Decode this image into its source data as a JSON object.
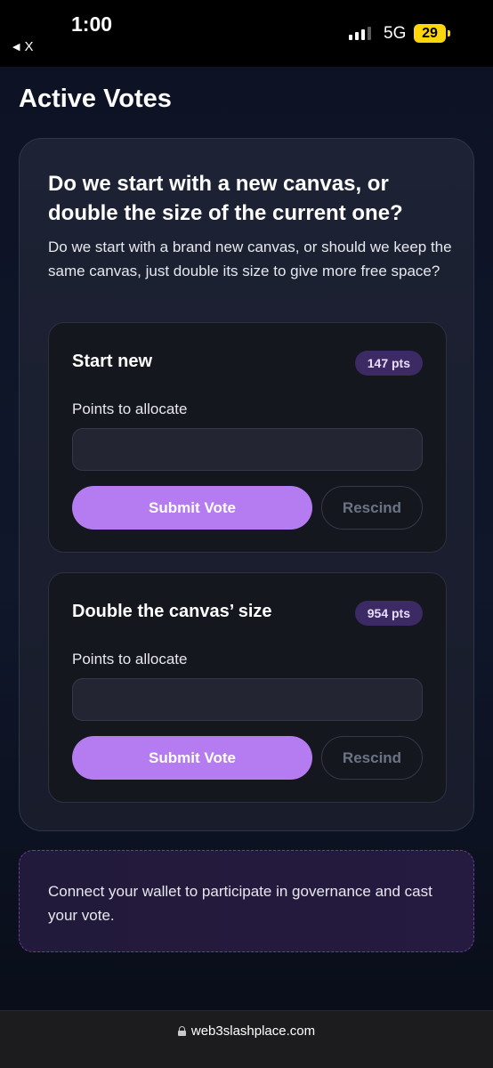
{
  "status_bar": {
    "time": "1:00",
    "back_label": "X",
    "network": "5G",
    "battery": "29"
  },
  "page": {
    "title": "Active Votes"
  },
  "proposal": {
    "title": "Do we start with a new canvas, or double the size of the current one?",
    "description": "Do we start with a brand new canvas, or should we keep the same canvas, just double its size to give more free space?",
    "options": [
      {
        "title": "Start new",
        "points": "147 pts",
        "points_label": "Points to allocate",
        "input_value": "",
        "submit_label": "Submit Vote",
        "rescind_label": "Rescind"
      },
      {
        "title": "Double the canvas’ size",
        "points": "954 pts",
        "points_label": "Points to allocate",
        "input_value": "",
        "submit_label": "Submit Vote",
        "rescind_label": "Rescind"
      }
    ]
  },
  "wallet_banner": {
    "text": "Connect your wallet to participate in governance and cast your vote."
  },
  "url_bar": {
    "url": "web3slashplace.com"
  },
  "colors": {
    "accent": "#b57bf0",
    "badge_bg": "#3b2a63",
    "background": "#0e1220"
  }
}
